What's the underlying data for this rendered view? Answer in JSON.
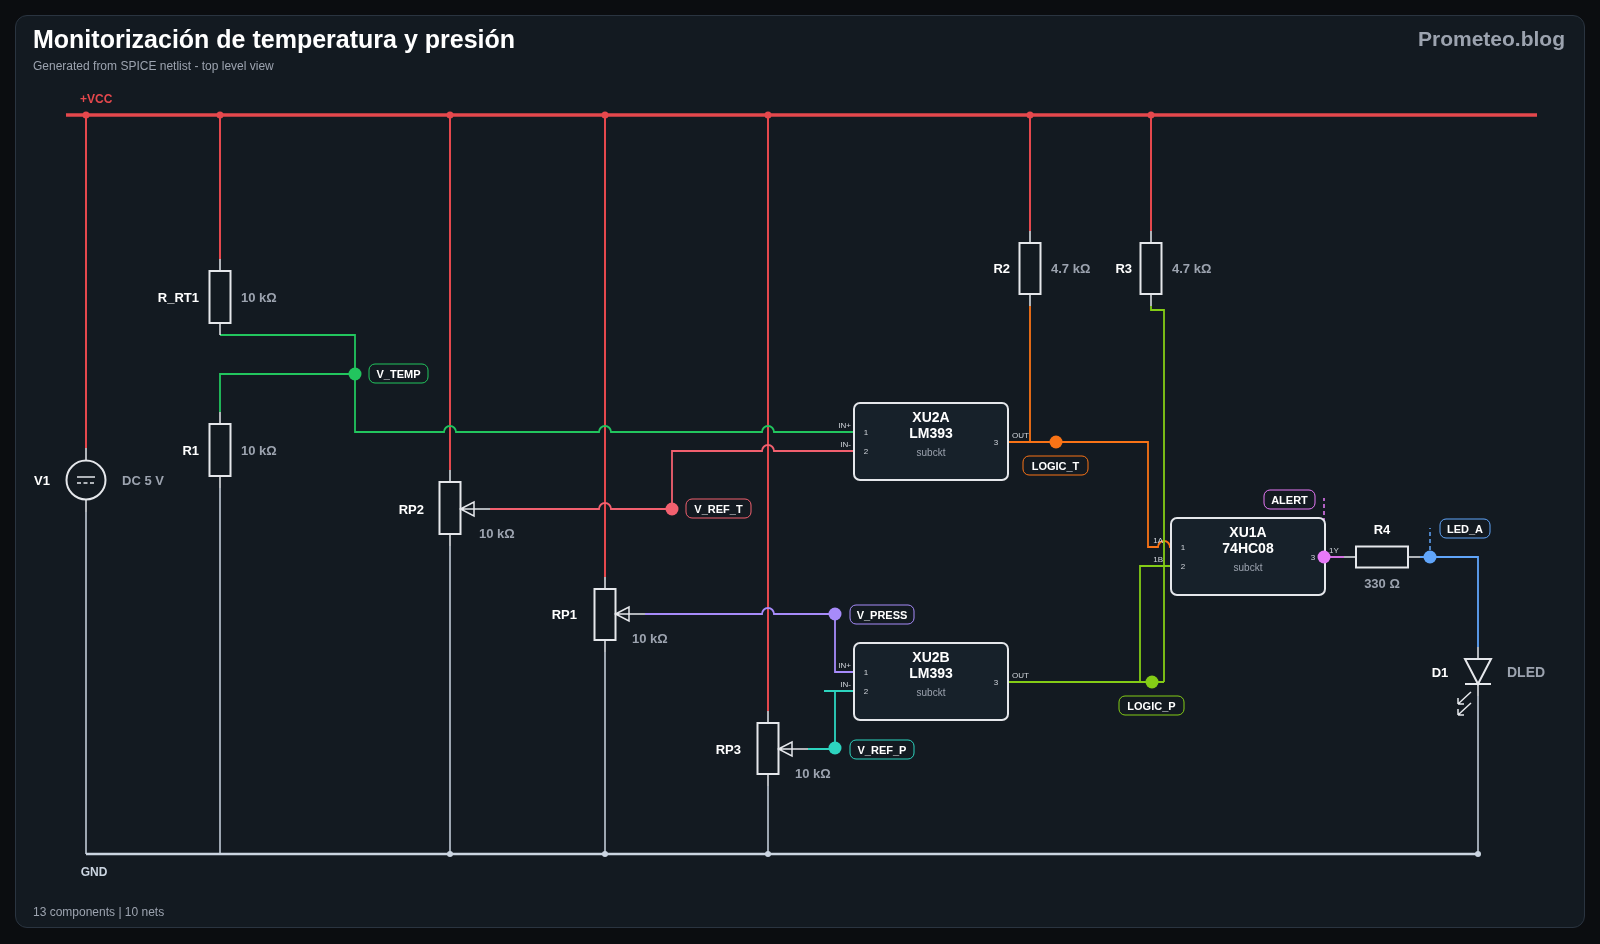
{
  "title": "Monitorización de temperatura y presión",
  "subtitle": "Generated from SPICE netlist - top level view",
  "brand": "Prometeo.blog",
  "rails": [
    {
      "label": "+VCC",
      "color": "#e5484d"
    },
    {
      "label": "GND",
      "color": "#cbd5e1"
    }
  ],
  "components": [
    {
      "kind": "source",
      "ref": "V1",
      "value": "DC 5 V"
    },
    {
      "kind": "resistor",
      "ref": "R_RT1",
      "value": "10 kΩ"
    },
    {
      "kind": "resistor",
      "ref": "R1",
      "value": "10 kΩ"
    },
    {
      "kind": "potentiometer",
      "ref": "RP2",
      "value": "10 kΩ"
    },
    {
      "kind": "potentiometer",
      "ref": "RP1",
      "value": "10 kΩ"
    },
    {
      "kind": "potentiometer",
      "ref": "RP3",
      "value": "10 kΩ"
    },
    {
      "kind": "resistor",
      "ref": "R2",
      "value": "4.7 kΩ"
    },
    {
      "kind": "resistor",
      "ref": "R3",
      "value": "4.7 kΩ"
    },
    {
      "kind": "subckt",
      "ref": "XU2A",
      "part": "LM393",
      "type_label": "subckt",
      "left_pins": [
        {
          "name": "IN+",
          "number": "1"
        },
        {
          "name": "IN-",
          "number": "2"
        }
      ],
      "right_pins": [
        {
          "name": "OUT",
          "number": "3"
        }
      ]
    },
    {
      "kind": "subckt",
      "ref": "XU2B",
      "part": "LM393",
      "type_label": "subckt",
      "left_pins": [
        {
          "name": "IN+",
          "number": "1"
        },
        {
          "name": "IN-",
          "number": "2"
        }
      ],
      "right_pins": [
        {
          "name": "OUT",
          "number": "3"
        }
      ]
    },
    {
      "kind": "subckt",
      "ref": "XU1A",
      "part": "74HC08",
      "type_label": "subckt",
      "left_pins": [
        {
          "name": "1A",
          "number": "1"
        },
        {
          "name": "1B",
          "number": "2"
        }
      ],
      "right_pins": [
        {
          "name": "1Y",
          "number": "3"
        }
      ]
    },
    {
      "kind": "resistor",
      "ref": "R4",
      "value": "330 Ω"
    },
    {
      "kind": "led",
      "ref": "D1",
      "value": "DLED"
    }
  ],
  "nets": [
    {
      "name": "V_TEMP",
      "color": "#22c55e"
    },
    {
      "name": "V_REF_T",
      "color": "#f2606f"
    },
    {
      "name": "V_PRESS",
      "color": "#a78bfa"
    },
    {
      "name": "V_REF_P",
      "color": "#2dd4bf"
    },
    {
      "name": "LOGIC_T",
      "color": "#f97316"
    },
    {
      "name": "LOGIC_P",
      "color": "#84cc16"
    },
    {
      "name": "ALERT",
      "color": "#e879f9"
    },
    {
      "name": "LED_A",
      "color": "#60a5fa"
    }
  ],
  "footer": "13 components | 10 nets"
}
